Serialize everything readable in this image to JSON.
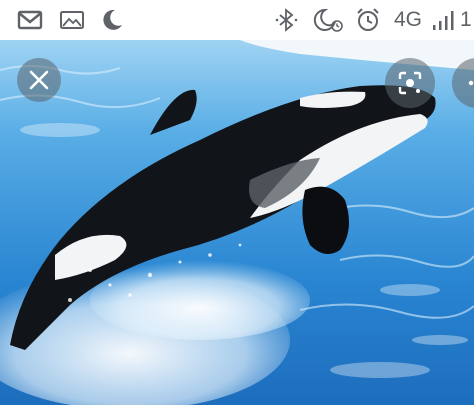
{
  "status_bar": {
    "left_icons": [
      "gmail-icon",
      "gallery-icon",
      "night-mode-icon"
    ],
    "right_icons": [
      "bluetooth-icon",
      "do-not-disturb-alarm-icon",
      "alarm-clock-icon",
      "signal-bars-icon"
    ],
    "network_label": "4G",
    "trailing_text": "1"
  },
  "viewer": {
    "close_icon": "close-icon",
    "lens_icon": "lens-search-icon",
    "image_subject": "orca-breaching"
  },
  "colors": {
    "water_light": "#6fb6e8",
    "water_deep": "#1f74c4",
    "orca_black": "#111418",
    "orca_white": "#f2f4f6",
    "status_icon": "#5f6368"
  }
}
